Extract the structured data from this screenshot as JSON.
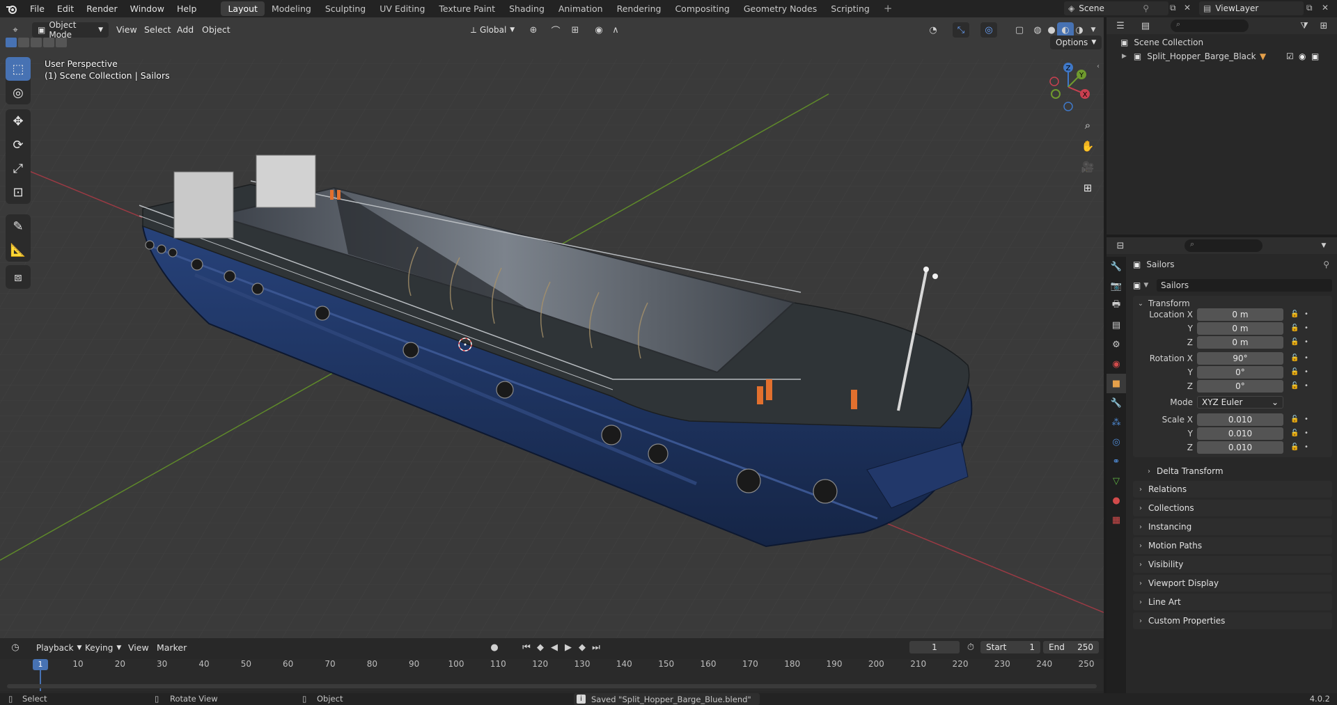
{
  "menubar": {
    "items": [
      "File",
      "Edit",
      "Render",
      "Window",
      "Help"
    ]
  },
  "workspaces": {
    "tabs": [
      "Layout",
      "Modeling",
      "Sculpting",
      "UV Editing",
      "Texture Paint",
      "Shading",
      "Animation",
      "Rendering",
      "Compositing",
      "Geometry Nodes",
      "Scripting"
    ],
    "active": "Layout",
    "add": "+"
  },
  "scene": {
    "label": "Scene",
    "view_layer": "ViewLayer"
  },
  "viewport": {
    "mode": "Object Mode",
    "menus": [
      "View",
      "Select",
      "Add",
      "Object"
    ],
    "orientation": "Global",
    "options": "Options",
    "overlay_line1": "User Perspective",
    "overlay_line2": "(1) Scene Collection | Sailors",
    "gizmo": {
      "x": "X",
      "y": "Y",
      "z": "Z"
    }
  },
  "outliner": {
    "root": "Scene Collection",
    "items": [
      {
        "name": "Split_Hopper_Barge_Black"
      }
    ]
  },
  "properties": {
    "object_name": "Sailors",
    "data_name": "Sailors",
    "transform": {
      "title": "Transform",
      "location_label": "Location X",
      "y_label": "Y",
      "z_label": "Z",
      "location": [
        "0 m",
        "0 m",
        "0 m"
      ],
      "rotation_label": "Rotation X",
      "rotation": [
        "90°",
        "0°",
        "0°"
      ],
      "mode_label": "Mode",
      "mode": "XYZ Euler",
      "scale_label": "Scale X",
      "scale": [
        "0.010",
        "0.010",
        "0.010"
      ],
      "delta": "Delta Transform"
    },
    "panels": [
      "Relations",
      "Collections",
      "Instancing",
      "Motion Paths",
      "Visibility",
      "Viewport Display",
      "Line Art",
      "Custom Properties"
    ]
  },
  "timeline": {
    "menus": [
      "Playback",
      "Keying",
      "View",
      "Marker"
    ],
    "current_frame": "1",
    "start_label": "Start",
    "start": "1",
    "end_label": "End",
    "end": "250",
    "ticks": [
      "1",
      "10",
      "20",
      "30",
      "40",
      "50",
      "60",
      "70",
      "80",
      "90",
      "100",
      "110",
      "120",
      "130",
      "140",
      "150",
      "160",
      "170",
      "180",
      "190",
      "200",
      "210",
      "220",
      "230",
      "240",
      "250"
    ]
  },
  "statusbar": {
    "select": "Select",
    "rotate": "Rotate View",
    "object": "Object",
    "message": "Saved \"Split_Hopper_Barge_Blue.blend\"",
    "version": "4.0.2"
  },
  "colors": {
    "accent": "#4772b3",
    "x_axis": "#c94050",
    "y_axis": "#6f9a2e",
    "z_axis": "#3f78c8",
    "hull": "#1c3260",
    "deck": "#2f3336"
  }
}
